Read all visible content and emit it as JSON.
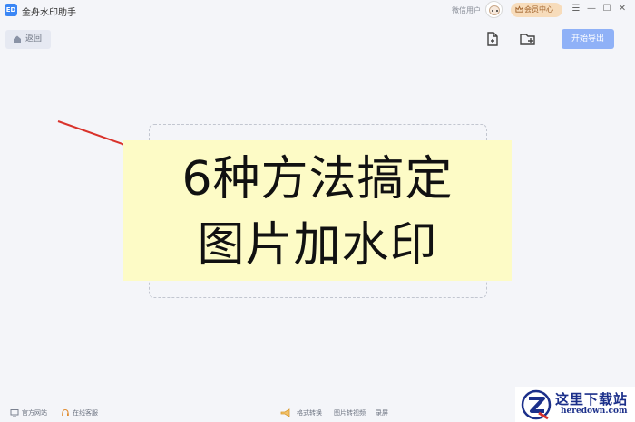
{
  "titlebar": {
    "app_logo_text": "ED",
    "app_title": "金舟水印助手",
    "user_name": "微信用户",
    "member_center": "会员中心",
    "controls": [
      "☰",
      "—",
      "☐",
      "✕"
    ]
  },
  "toolbar": {
    "back_label": "返回",
    "export_label": "开始导出",
    "icons": [
      "add-file-icon",
      "add-folder-icon"
    ]
  },
  "banner": {
    "line1": "6种方法搞定",
    "line2": "图片加水印"
  },
  "footer": {
    "website": "官方网站",
    "support": "在线客服",
    "format_convert": "格式转换",
    "image_to_video": "图片转视频",
    "screen_record": "录屏"
  },
  "watermark": {
    "title": "这里下载站",
    "url": "heredown.com"
  },
  "colors": {
    "accent": "#3a86f5",
    "export_button": "#8fb1f7",
    "member_badge": "#f7dcbb",
    "banner_bg": "#fdfbc6",
    "pointer": "#d9322b"
  }
}
